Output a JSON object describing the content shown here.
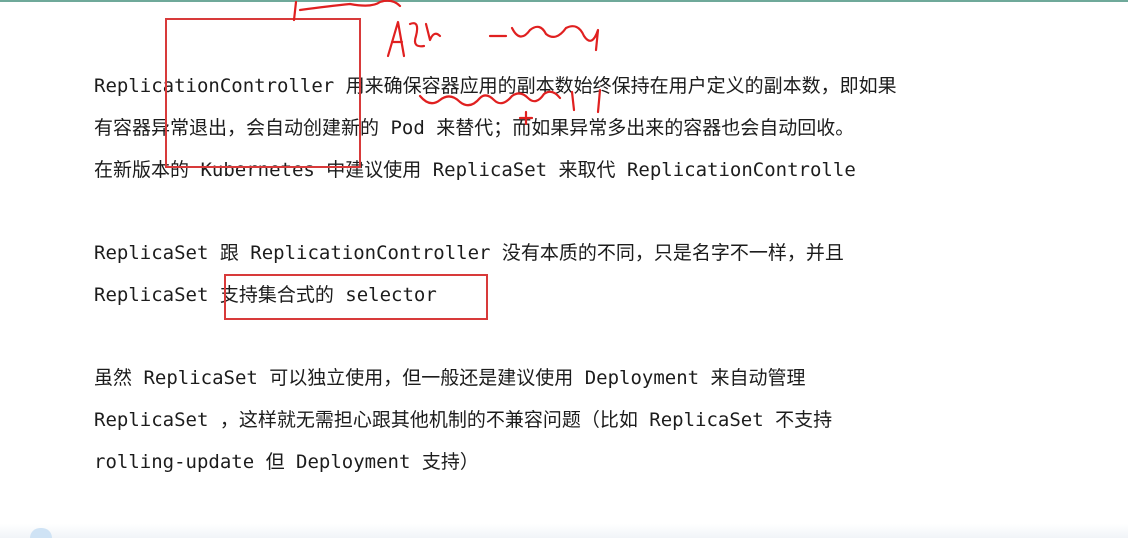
{
  "paragraphs": {
    "p1": {
      "line1": "ReplicationController 用来确保容器应用的副本数始终保持在用户定义的副本数，即如果",
      "line2": "有容器异常退出，会自动创建新的 Pod 来替代；而如果异常多出来的容器也会自动回收。",
      "line3": "在新版本的 Kubernetes 中建议使用 ReplicaSet 来取代 ReplicationControlle"
    },
    "p2": {
      "line1": "ReplicaSet 跟 ReplicationController 没有本质的不同，只是名字不一样，并且",
      "line2": "ReplicaSet 支持集合式的 selector"
    },
    "p3": {
      "line1": "虽然 ReplicaSet 可以独立使用，但一般还是建议使用 Deployment 来自动管理",
      "line2": "ReplicaSet ，这样就无需担心跟其他机制的不兼容问题（比如 ReplicaSet 不支持",
      "line3": "rolling-update 但 Deployment 支持）"
    }
  },
  "annotations": {
    "box_color": "#d83a3a",
    "ink_color": "#e02020"
  },
  "colors": {
    "text": "#1c1c1c",
    "background": "#ffffff",
    "top_rule": "#6fa99a"
  }
}
